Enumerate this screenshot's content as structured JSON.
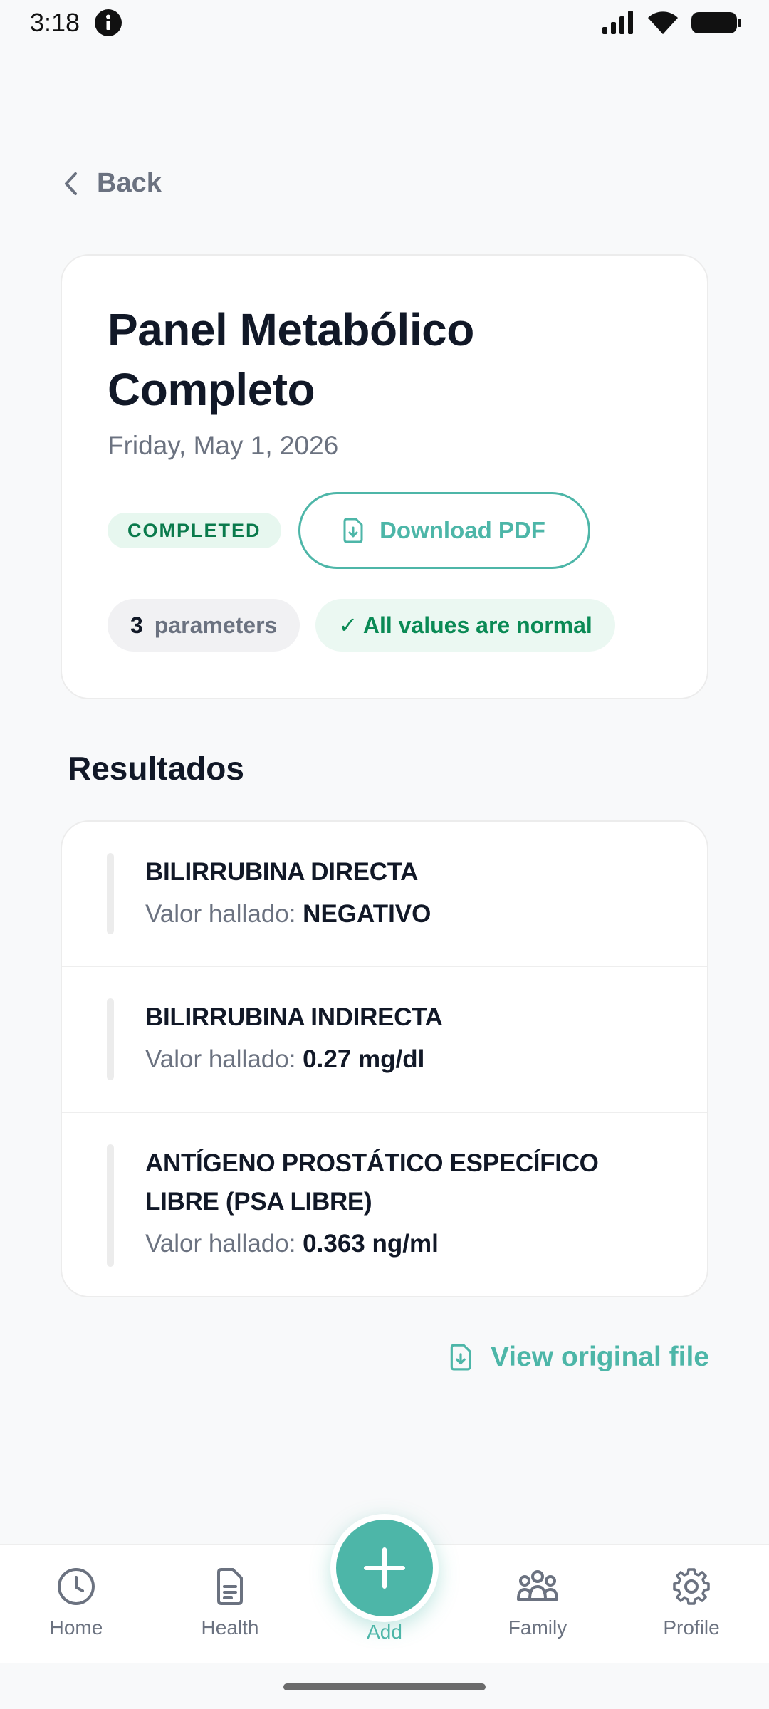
{
  "status_bar": {
    "time": "3:18"
  },
  "navigation": {
    "back_label": "Back"
  },
  "summary": {
    "title": "Panel Metabólico Completo",
    "date": "Friday, May 1, 2026",
    "status_badge": "COMPLETED",
    "download_label": "Download PDF",
    "parameters_count": "3",
    "parameters_label": "parameters",
    "normal_label": "✓ All values are normal"
  },
  "results": {
    "section_title": "Resultados",
    "value_prefix": "Valor hallado:",
    "items": [
      {
        "name": "BILIRRUBINA DIRECTA",
        "value": "NEGATIVO"
      },
      {
        "name": "BILIRRUBINA INDIRECTA",
        "value": "0.27 mg/dl"
      },
      {
        "name": "ANTÍGENO PROSTÁTICO ESPECÍFICO LIBRE (PSA LIBRE)",
        "value": "0.363 ng/ml"
      }
    ]
  },
  "view_original_label": "View original file",
  "bottom_nav": {
    "home": "Home",
    "health": "Health",
    "add": "Add",
    "family": "Family",
    "profile": "Profile"
  },
  "colors": {
    "accent": "#4db6a8",
    "success": "#0a8a55",
    "text_primary": "#111827",
    "text_secondary": "#6b7280"
  }
}
